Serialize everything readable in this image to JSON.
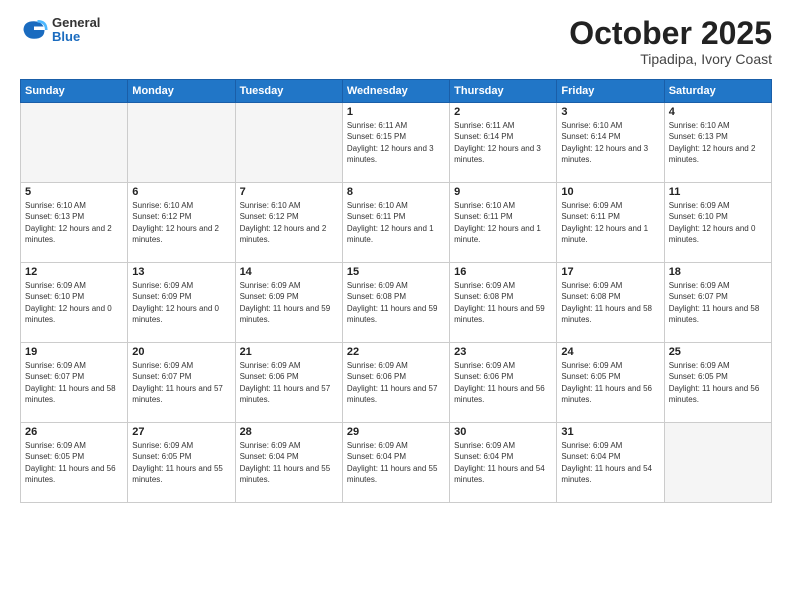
{
  "header": {
    "logo": {
      "general": "General",
      "blue": "Blue"
    },
    "title": "October 2025",
    "location": "Tipadipa, Ivory Coast"
  },
  "weekdays": [
    "Sunday",
    "Monday",
    "Tuesday",
    "Wednesday",
    "Thursday",
    "Friday",
    "Saturday"
  ],
  "weeks": [
    [
      {
        "day": "",
        "sunrise": "",
        "sunset": "",
        "daylight": "",
        "empty": true
      },
      {
        "day": "",
        "sunrise": "",
        "sunset": "",
        "daylight": "",
        "empty": true
      },
      {
        "day": "",
        "sunrise": "",
        "sunset": "",
        "daylight": "",
        "empty": true
      },
      {
        "day": "1",
        "sunrise": "Sunrise: 6:11 AM",
        "sunset": "Sunset: 6:15 PM",
        "daylight": "Daylight: 12 hours and 3 minutes.",
        "empty": false
      },
      {
        "day": "2",
        "sunrise": "Sunrise: 6:11 AM",
        "sunset": "Sunset: 6:14 PM",
        "daylight": "Daylight: 12 hours and 3 minutes.",
        "empty": false
      },
      {
        "day": "3",
        "sunrise": "Sunrise: 6:10 AM",
        "sunset": "Sunset: 6:14 PM",
        "daylight": "Daylight: 12 hours and 3 minutes.",
        "empty": false
      },
      {
        "day": "4",
        "sunrise": "Sunrise: 6:10 AM",
        "sunset": "Sunset: 6:13 PM",
        "daylight": "Daylight: 12 hours and 2 minutes.",
        "empty": false
      }
    ],
    [
      {
        "day": "5",
        "sunrise": "Sunrise: 6:10 AM",
        "sunset": "Sunset: 6:13 PM",
        "daylight": "Daylight: 12 hours and 2 minutes.",
        "empty": false
      },
      {
        "day": "6",
        "sunrise": "Sunrise: 6:10 AM",
        "sunset": "Sunset: 6:12 PM",
        "daylight": "Daylight: 12 hours and 2 minutes.",
        "empty": false
      },
      {
        "day": "7",
        "sunrise": "Sunrise: 6:10 AM",
        "sunset": "Sunset: 6:12 PM",
        "daylight": "Daylight: 12 hours and 2 minutes.",
        "empty": false
      },
      {
        "day": "8",
        "sunrise": "Sunrise: 6:10 AM",
        "sunset": "Sunset: 6:11 PM",
        "daylight": "Daylight: 12 hours and 1 minute.",
        "empty": false
      },
      {
        "day": "9",
        "sunrise": "Sunrise: 6:10 AM",
        "sunset": "Sunset: 6:11 PM",
        "daylight": "Daylight: 12 hours and 1 minute.",
        "empty": false
      },
      {
        "day": "10",
        "sunrise": "Sunrise: 6:09 AM",
        "sunset": "Sunset: 6:11 PM",
        "daylight": "Daylight: 12 hours and 1 minute.",
        "empty": false
      },
      {
        "day": "11",
        "sunrise": "Sunrise: 6:09 AM",
        "sunset": "Sunset: 6:10 PM",
        "daylight": "Daylight: 12 hours and 0 minutes.",
        "empty": false
      }
    ],
    [
      {
        "day": "12",
        "sunrise": "Sunrise: 6:09 AM",
        "sunset": "Sunset: 6:10 PM",
        "daylight": "Daylight: 12 hours and 0 minutes.",
        "empty": false
      },
      {
        "day": "13",
        "sunrise": "Sunrise: 6:09 AM",
        "sunset": "Sunset: 6:09 PM",
        "daylight": "Daylight: 12 hours and 0 minutes.",
        "empty": false
      },
      {
        "day": "14",
        "sunrise": "Sunrise: 6:09 AM",
        "sunset": "Sunset: 6:09 PM",
        "daylight": "Daylight: 11 hours and 59 minutes.",
        "empty": false
      },
      {
        "day": "15",
        "sunrise": "Sunrise: 6:09 AM",
        "sunset": "Sunset: 6:08 PM",
        "daylight": "Daylight: 11 hours and 59 minutes.",
        "empty": false
      },
      {
        "day": "16",
        "sunrise": "Sunrise: 6:09 AM",
        "sunset": "Sunset: 6:08 PM",
        "daylight": "Daylight: 11 hours and 59 minutes.",
        "empty": false
      },
      {
        "day": "17",
        "sunrise": "Sunrise: 6:09 AM",
        "sunset": "Sunset: 6:08 PM",
        "daylight": "Daylight: 11 hours and 58 minutes.",
        "empty": false
      },
      {
        "day": "18",
        "sunrise": "Sunrise: 6:09 AM",
        "sunset": "Sunset: 6:07 PM",
        "daylight": "Daylight: 11 hours and 58 minutes.",
        "empty": false
      }
    ],
    [
      {
        "day": "19",
        "sunrise": "Sunrise: 6:09 AM",
        "sunset": "Sunset: 6:07 PM",
        "daylight": "Daylight: 11 hours and 58 minutes.",
        "empty": false
      },
      {
        "day": "20",
        "sunrise": "Sunrise: 6:09 AM",
        "sunset": "Sunset: 6:07 PM",
        "daylight": "Daylight: 11 hours and 57 minutes.",
        "empty": false
      },
      {
        "day": "21",
        "sunrise": "Sunrise: 6:09 AM",
        "sunset": "Sunset: 6:06 PM",
        "daylight": "Daylight: 11 hours and 57 minutes.",
        "empty": false
      },
      {
        "day": "22",
        "sunrise": "Sunrise: 6:09 AM",
        "sunset": "Sunset: 6:06 PM",
        "daylight": "Daylight: 11 hours and 57 minutes.",
        "empty": false
      },
      {
        "day": "23",
        "sunrise": "Sunrise: 6:09 AM",
        "sunset": "Sunset: 6:06 PM",
        "daylight": "Daylight: 11 hours and 56 minutes.",
        "empty": false
      },
      {
        "day": "24",
        "sunrise": "Sunrise: 6:09 AM",
        "sunset": "Sunset: 6:05 PM",
        "daylight": "Daylight: 11 hours and 56 minutes.",
        "empty": false
      },
      {
        "day": "25",
        "sunrise": "Sunrise: 6:09 AM",
        "sunset": "Sunset: 6:05 PM",
        "daylight": "Daylight: 11 hours and 56 minutes.",
        "empty": false
      }
    ],
    [
      {
        "day": "26",
        "sunrise": "Sunrise: 6:09 AM",
        "sunset": "Sunset: 6:05 PM",
        "daylight": "Daylight: 11 hours and 56 minutes.",
        "empty": false
      },
      {
        "day": "27",
        "sunrise": "Sunrise: 6:09 AM",
        "sunset": "Sunset: 6:05 PM",
        "daylight": "Daylight: 11 hours and 55 minutes.",
        "empty": false
      },
      {
        "day": "28",
        "sunrise": "Sunrise: 6:09 AM",
        "sunset": "Sunset: 6:04 PM",
        "daylight": "Daylight: 11 hours and 55 minutes.",
        "empty": false
      },
      {
        "day": "29",
        "sunrise": "Sunrise: 6:09 AM",
        "sunset": "Sunset: 6:04 PM",
        "daylight": "Daylight: 11 hours and 55 minutes.",
        "empty": false
      },
      {
        "day": "30",
        "sunrise": "Sunrise: 6:09 AM",
        "sunset": "Sunset: 6:04 PM",
        "daylight": "Daylight: 11 hours and 54 minutes.",
        "empty": false
      },
      {
        "day": "31",
        "sunrise": "Sunrise: 6:09 AM",
        "sunset": "Sunset: 6:04 PM",
        "daylight": "Daylight: 11 hours and 54 minutes.",
        "empty": false
      },
      {
        "day": "",
        "sunrise": "",
        "sunset": "",
        "daylight": "",
        "empty": true
      }
    ]
  ]
}
